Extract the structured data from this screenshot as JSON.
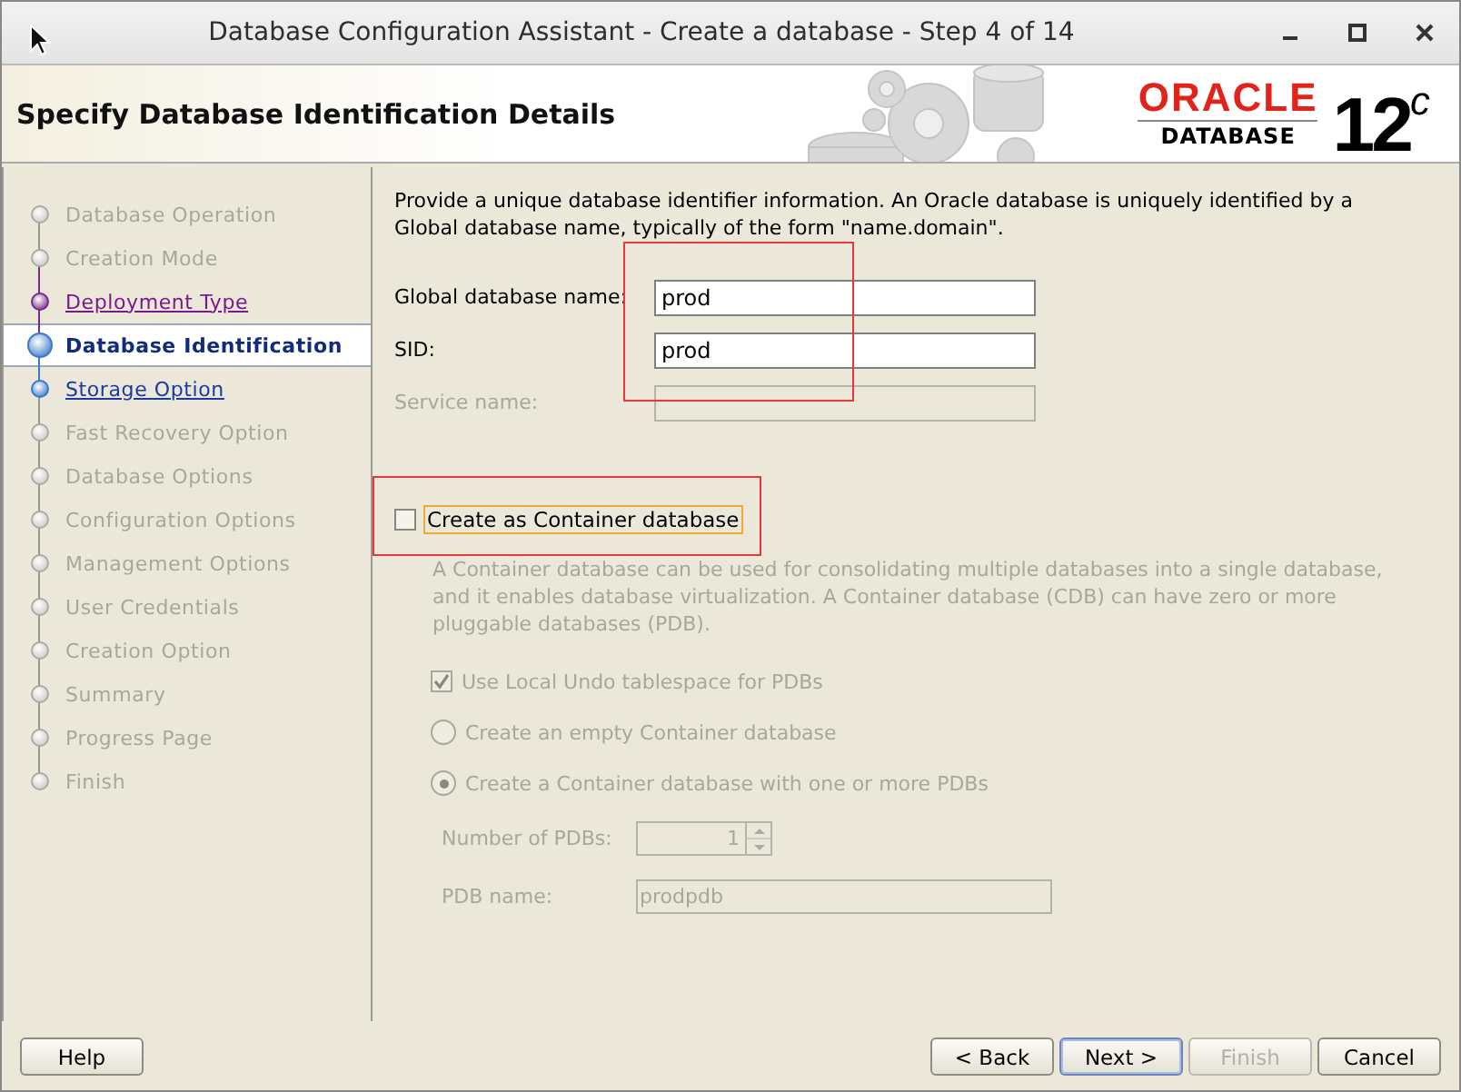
{
  "window": {
    "title": "Database Configuration Assistant - Create a database - Step 4 of 14"
  },
  "header": {
    "title": "Specify Database Identification Details",
    "brand": "ORACLE",
    "product": "DATABASE",
    "version": "12",
    "version_sup": "c"
  },
  "steps": [
    {
      "label": "Database Operation",
      "kind": "disabled"
    },
    {
      "label": "Creation Mode",
      "kind": "disabled"
    },
    {
      "label": "Deployment Type",
      "kind": "visited"
    },
    {
      "label": "Database Identification",
      "kind": "current"
    },
    {
      "label": "Storage Option",
      "kind": "link"
    },
    {
      "label": "Fast Recovery Option",
      "kind": "disabled"
    },
    {
      "label": "Database Options",
      "kind": "disabled"
    },
    {
      "label": "Configuration Options",
      "kind": "disabled"
    },
    {
      "label": "Management Options",
      "kind": "disabled"
    },
    {
      "label": "User Credentials",
      "kind": "disabled"
    },
    {
      "label": "Creation Option",
      "kind": "disabled"
    },
    {
      "label": "Summary",
      "kind": "disabled"
    },
    {
      "label": "Progress Page",
      "kind": "disabled"
    },
    {
      "label": "Finish",
      "kind": "disabled"
    }
  ],
  "intro": "Provide a unique database identifier information. An Oracle database is uniquely identified by a Global database name, typically of the form \"name.domain\".",
  "fields_highlighted": true,
  "fields": [
    {
      "label": "Global database name:",
      "value": "prod",
      "disabled": false
    },
    {
      "label": "SID:",
      "value": "prod",
      "disabled": false
    },
    {
      "label": "Service name:",
      "disabled": true
    }
  ],
  "container": {
    "label": "Create as Container database",
    "checked": false,
    "highlighted": true,
    "description": "A Container database can be used for consolidating multiple databases into a single database, and it enables database virtualization. A Container database (CDB) can have zero or more pluggable databases (PDB).",
    "options": [
      {
        "kind": "checkbox",
        "label": "Use Local Undo tablespace for PDBs",
        "checked": true,
        "disabled": true
      },
      {
        "kind": "radio",
        "label": "Create an empty Container database",
        "selected": false,
        "disabled": true
      },
      {
        "kind": "radio",
        "label": "Create a Container database with one or more PDBs",
        "selected": true,
        "disabled": true
      }
    ],
    "pdb_count": {
      "label": "Number of PDBs:",
      "value": "1",
      "disabled": true
    },
    "pdb_name": {
      "label": "PDB name:",
      "value": "prodpdb",
      "disabled": true
    }
  },
  "left_buttons": [
    {
      "label": "Help",
      "disabled": false,
      "default": false
    }
  ],
  "right_buttons": [
    {
      "label": "< Back",
      "disabled": false,
      "default": false
    },
    {
      "label": "Next >",
      "disabled": false,
      "default": true
    },
    {
      "label": "Finish",
      "disabled": true,
      "default": false
    },
    {
      "label": "Cancel",
      "disabled": false,
      "default": false
    }
  ]
}
